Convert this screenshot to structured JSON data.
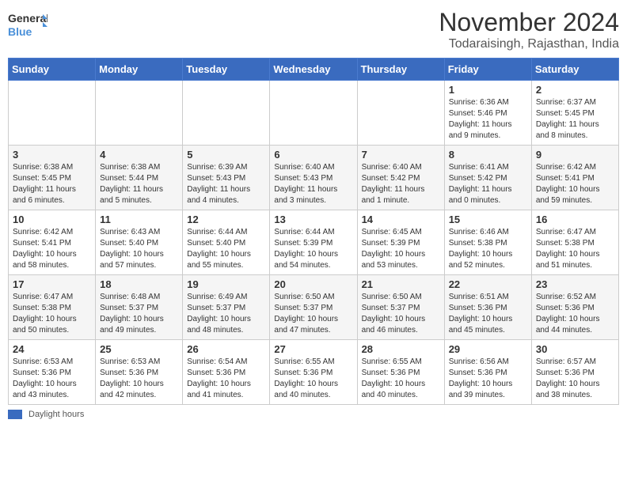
{
  "logo": {
    "line1": "General",
    "line2": "Blue"
  },
  "title": "November 2024",
  "subtitle": "Todaraisingh, Rajasthan, India",
  "weekdays": [
    "Sunday",
    "Monday",
    "Tuesday",
    "Wednesday",
    "Thursday",
    "Friday",
    "Saturday"
  ],
  "footer_label": "Daylight hours",
  "weeks": [
    [
      {
        "day": "",
        "info": ""
      },
      {
        "day": "",
        "info": ""
      },
      {
        "day": "",
        "info": ""
      },
      {
        "day": "",
        "info": ""
      },
      {
        "day": "",
        "info": ""
      },
      {
        "day": "1",
        "info": "Sunrise: 6:36 AM\nSunset: 5:46 PM\nDaylight: 11 hours and 9 minutes."
      },
      {
        "day": "2",
        "info": "Sunrise: 6:37 AM\nSunset: 5:45 PM\nDaylight: 11 hours and 8 minutes."
      }
    ],
    [
      {
        "day": "3",
        "info": "Sunrise: 6:38 AM\nSunset: 5:45 PM\nDaylight: 11 hours and 6 minutes."
      },
      {
        "day": "4",
        "info": "Sunrise: 6:38 AM\nSunset: 5:44 PM\nDaylight: 11 hours and 5 minutes."
      },
      {
        "day": "5",
        "info": "Sunrise: 6:39 AM\nSunset: 5:43 PM\nDaylight: 11 hours and 4 minutes."
      },
      {
        "day": "6",
        "info": "Sunrise: 6:40 AM\nSunset: 5:43 PM\nDaylight: 11 hours and 3 minutes."
      },
      {
        "day": "7",
        "info": "Sunrise: 6:40 AM\nSunset: 5:42 PM\nDaylight: 11 hours and 1 minute."
      },
      {
        "day": "8",
        "info": "Sunrise: 6:41 AM\nSunset: 5:42 PM\nDaylight: 11 hours and 0 minutes."
      },
      {
        "day": "9",
        "info": "Sunrise: 6:42 AM\nSunset: 5:41 PM\nDaylight: 10 hours and 59 minutes."
      }
    ],
    [
      {
        "day": "10",
        "info": "Sunrise: 6:42 AM\nSunset: 5:41 PM\nDaylight: 10 hours and 58 minutes."
      },
      {
        "day": "11",
        "info": "Sunrise: 6:43 AM\nSunset: 5:40 PM\nDaylight: 10 hours and 57 minutes."
      },
      {
        "day": "12",
        "info": "Sunrise: 6:44 AM\nSunset: 5:40 PM\nDaylight: 10 hours and 55 minutes."
      },
      {
        "day": "13",
        "info": "Sunrise: 6:44 AM\nSunset: 5:39 PM\nDaylight: 10 hours and 54 minutes."
      },
      {
        "day": "14",
        "info": "Sunrise: 6:45 AM\nSunset: 5:39 PM\nDaylight: 10 hours and 53 minutes."
      },
      {
        "day": "15",
        "info": "Sunrise: 6:46 AM\nSunset: 5:38 PM\nDaylight: 10 hours and 52 minutes."
      },
      {
        "day": "16",
        "info": "Sunrise: 6:47 AM\nSunset: 5:38 PM\nDaylight: 10 hours and 51 minutes."
      }
    ],
    [
      {
        "day": "17",
        "info": "Sunrise: 6:47 AM\nSunset: 5:38 PM\nDaylight: 10 hours and 50 minutes."
      },
      {
        "day": "18",
        "info": "Sunrise: 6:48 AM\nSunset: 5:37 PM\nDaylight: 10 hours and 49 minutes."
      },
      {
        "day": "19",
        "info": "Sunrise: 6:49 AM\nSunset: 5:37 PM\nDaylight: 10 hours and 48 minutes."
      },
      {
        "day": "20",
        "info": "Sunrise: 6:50 AM\nSunset: 5:37 PM\nDaylight: 10 hours and 47 minutes."
      },
      {
        "day": "21",
        "info": "Sunrise: 6:50 AM\nSunset: 5:37 PM\nDaylight: 10 hours and 46 minutes."
      },
      {
        "day": "22",
        "info": "Sunrise: 6:51 AM\nSunset: 5:36 PM\nDaylight: 10 hours and 45 minutes."
      },
      {
        "day": "23",
        "info": "Sunrise: 6:52 AM\nSunset: 5:36 PM\nDaylight: 10 hours and 44 minutes."
      }
    ],
    [
      {
        "day": "24",
        "info": "Sunrise: 6:53 AM\nSunset: 5:36 PM\nDaylight: 10 hours and 43 minutes."
      },
      {
        "day": "25",
        "info": "Sunrise: 6:53 AM\nSunset: 5:36 PM\nDaylight: 10 hours and 42 minutes."
      },
      {
        "day": "26",
        "info": "Sunrise: 6:54 AM\nSunset: 5:36 PM\nDaylight: 10 hours and 41 minutes."
      },
      {
        "day": "27",
        "info": "Sunrise: 6:55 AM\nSunset: 5:36 PM\nDaylight: 10 hours and 40 minutes."
      },
      {
        "day": "28",
        "info": "Sunrise: 6:55 AM\nSunset: 5:36 PM\nDaylight: 10 hours and 40 minutes."
      },
      {
        "day": "29",
        "info": "Sunrise: 6:56 AM\nSunset: 5:36 PM\nDaylight: 10 hours and 39 minutes."
      },
      {
        "day": "30",
        "info": "Sunrise: 6:57 AM\nSunset: 5:36 PM\nDaylight: 10 hours and 38 minutes."
      }
    ]
  ]
}
